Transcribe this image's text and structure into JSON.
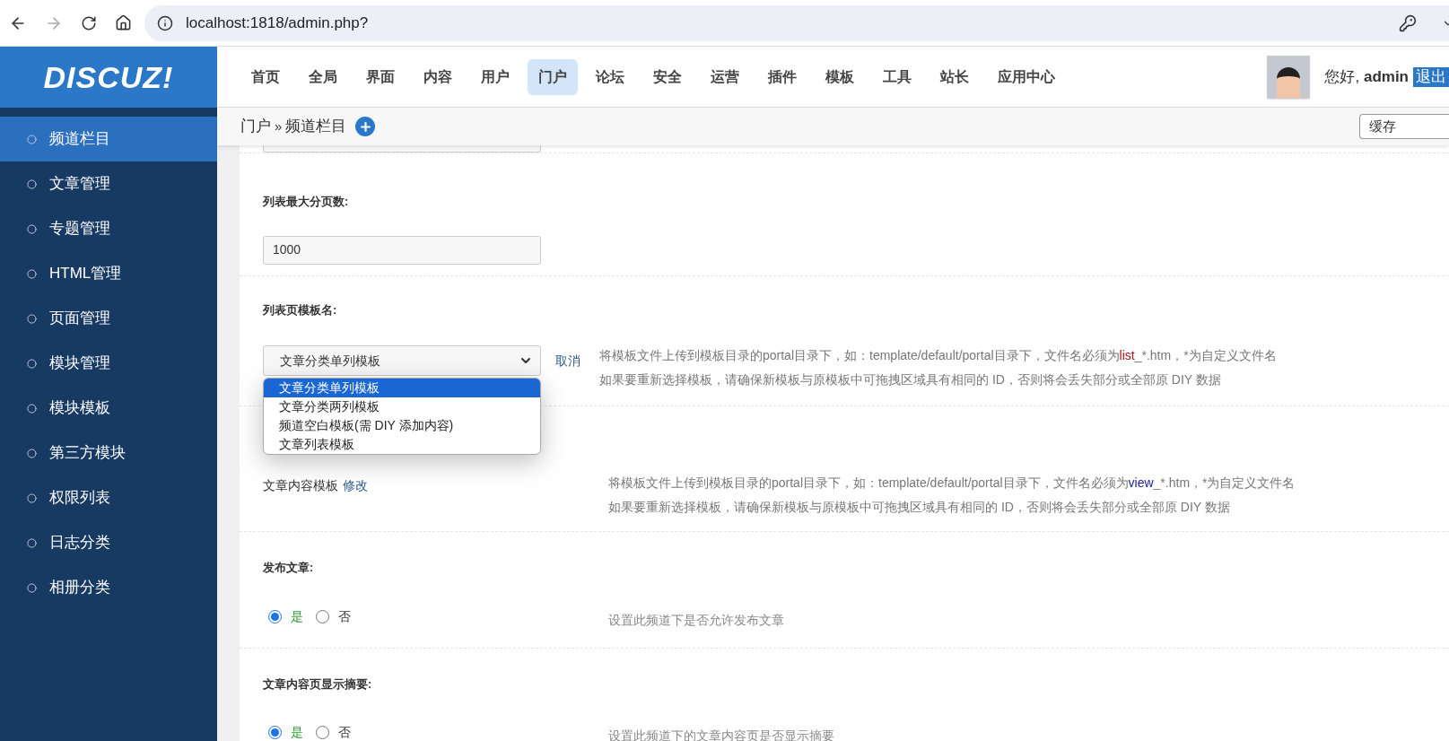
{
  "browser": {
    "url": "localhost:1818/admin.php?"
  },
  "header": {
    "logo": "DISCUZ!",
    "nav": [
      {
        "label": "首页",
        "selected": false
      },
      {
        "label": "全局",
        "selected": false
      },
      {
        "label": "界面",
        "selected": false
      },
      {
        "label": "内容",
        "selected": false
      },
      {
        "label": "用户",
        "selected": false
      },
      {
        "label": "门户",
        "selected": true
      },
      {
        "label": "论坛",
        "selected": false
      },
      {
        "label": "安全",
        "selected": false
      },
      {
        "label": "运营",
        "selected": false
      },
      {
        "label": "插件",
        "selected": false
      },
      {
        "label": "模板",
        "selected": false
      },
      {
        "label": "工具",
        "selected": false
      },
      {
        "label": "站长",
        "selected": false
      },
      {
        "label": "应用中心",
        "selected": false
      }
    ],
    "greeting": "您好,",
    "username": "admin",
    "logout": "退出"
  },
  "breadcrumb": {
    "section": "门户",
    "separator": "»",
    "page": "频道栏目",
    "cache_select": "缓存"
  },
  "sidebar": {
    "items": [
      {
        "label": "频道栏目",
        "selected": true
      },
      {
        "label": "文章管理",
        "selected": false
      },
      {
        "label": "专题管理",
        "selected": false
      },
      {
        "label": "HTML管理",
        "selected": false
      },
      {
        "label": "页面管理",
        "selected": false
      },
      {
        "label": "模块管理",
        "selected": false
      },
      {
        "label": "模块模板",
        "selected": false
      },
      {
        "label": "第三方模块",
        "selected": false
      },
      {
        "label": "权限列表",
        "selected": false
      },
      {
        "label": "日志分类",
        "selected": false
      },
      {
        "label": "相册分类",
        "selected": false
      }
    ]
  },
  "settings": [
    {
      "kind": "partial_field"
    },
    {
      "kind": "text_input",
      "label": "列表最大分页数:",
      "value": "1000"
    },
    {
      "kind": "template_select",
      "label": "列表页模板名:",
      "value": "文章分类单列模板",
      "cancel": "取消",
      "options": [
        {
          "label": "文章分类单列模板",
          "selected": true
        },
        {
          "label": "文章分类两列模板",
          "selected": false
        },
        {
          "label": "频道空白模板(需 DIY 添加内容)",
          "selected": false
        },
        {
          "label": "文章列表模板",
          "selected": false
        }
      ],
      "note": {
        "kind": "list",
        "before": "将模板文件上传到模板目录的portal目录下，如：template/default/portal目录下，文件名必须为",
        "prefix": "list",
        "after": "_*.htm，*为自定义文件名",
        "line2": "如果要重新选择模板，请确保新模板与原模板中可拖拽区域具有相同的 ID，否则将会丢失部分或全部原 DIY 数据"
      }
    },
    {
      "kind": "template_text",
      "value": "文章内容模板",
      "edit": "修改",
      "note": {
        "kind": "view",
        "before": "将模板文件上传到模板目录的portal目录下，如：template/default/portal目录下，文件名必须为",
        "prefix": "view",
        "after": "_*.htm，*为自定义文件名",
        "line2": "如果要重新选择模板，请确保新模板与原模板中可拖拽区域具有相同的 ID，否则将会丢失部分或全部原 DIY 数据"
      }
    },
    {
      "kind": "radio",
      "label": "发布文章:",
      "options": [
        {
          "label": "是",
          "selected": true
        },
        {
          "label": "否",
          "selected": false
        }
      ],
      "hint": "设置此频道下是否允许发布文章"
    },
    {
      "kind": "radio",
      "label": "文章内容页显示摘要:",
      "options": [
        {
          "label": "是",
          "selected": true
        },
        {
          "label": "否",
          "selected": false
        }
      ],
      "hint": "设置此频道下的文章内容页是否显示摘要"
    }
  ]
}
